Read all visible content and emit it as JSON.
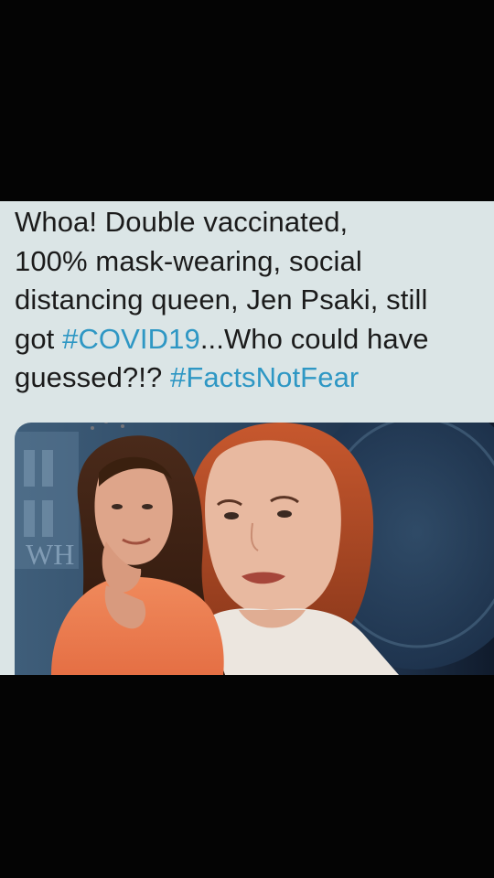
{
  "post": {
    "text_line_1": "Whoa! Double vaccinated,",
    "text_line_2": "100% mask-wearing, social",
    "text_line_3": "distancing queen, Jen Psaki, still",
    "text_line_4_prefix": "got ",
    "hashtag_covid": "#COVID19",
    "text_line_4_suffix": "...Who could have",
    "text_line_5_prefix": "guessed?!? ",
    "hashtag_facts": "#FactsNotFear",
    "hashtag_color": "#2e97c4",
    "text_color": "#1b1b1b",
    "card_background": "#dbe5e6"
  },
  "media": {
    "background_sign_text": "WH"
  }
}
